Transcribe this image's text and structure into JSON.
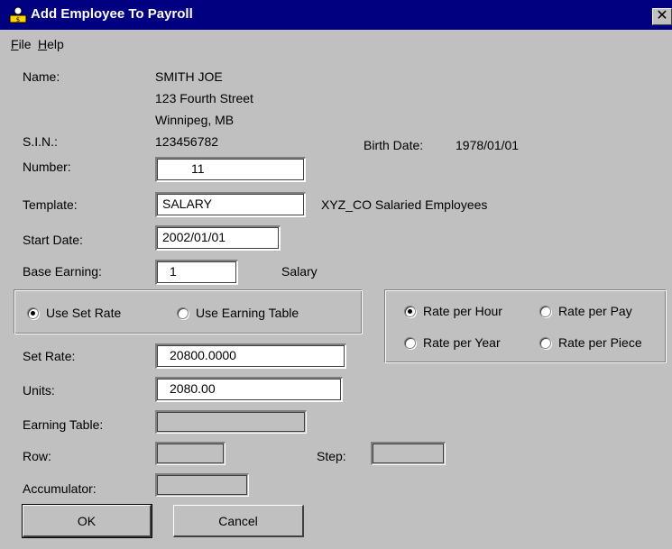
{
  "window": {
    "title": "Add Employee To Payroll",
    "close_glyph": "✕"
  },
  "menu": {
    "items": [
      {
        "label": "File",
        "hotkey": "F"
      },
      {
        "label": "Help",
        "hotkey": "H"
      }
    ]
  },
  "employee": {
    "name_label": "Name:",
    "name": "SMITH JOE",
    "address1": "123 Fourth Street",
    "address2": "Winnipeg, MB",
    "sin_label": "S.I.N.:",
    "sin": "123456782",
    "birth_label": "Birth Date:",
    "birth_date": "1978/01/01"
  },
  "form": {
    "number_label": "Number:",
    "number_value": "11",
    "template_label": "Template:",
    "template_value": "SALARY",
    "template_desc": "XYZ_CO Salaried Employees",
    "start_label": "Start Date:",
    "start_value": "2002/01/01",
    "base_label": "Base Earning:",
    "base_value": "1",
    "base_desc": "Salary",
    "set_rate_label": "Set Rate:",
    "set_rate_value": "20800.0000",
    "units_label": "Units:",
    "units_value": "2080.00",
    "earning_table_label": "Earning Table:",
    "earning_table_value": "",
    "row_label": "Row:",
    "row_value": "",
    "step_label": "Step:",
    "step_value": "",
    "accumulator_label": "Accumulator:",
    "accumulator_value": ""
  },
  "rate_source": {
    "options": [
      {
        "label": "Use Set Rate",
        "checked": true
      },
      {
        "label": "Use Earning Table",
        "checked": false
      }
    ]
  },
  "rate_type": {
    "options": [
      {
        "label": "Rate per Hour",
        "checked": true
      },
      {
        "label": "Rate per Pay",
        "checked": false
      },
      {
        "label": "Rate per Year",
        "checked": false
      },
      {
        "label": "Rate per Piece",
        "checked": false
      }
    ]
  },
  "buttons": {
    "ok": "OK",
    "cancel": "Cancel"
  },
  "colors": {
    "titlebar": "#000080",
    "face": "#c0c0c0"
  }
}
